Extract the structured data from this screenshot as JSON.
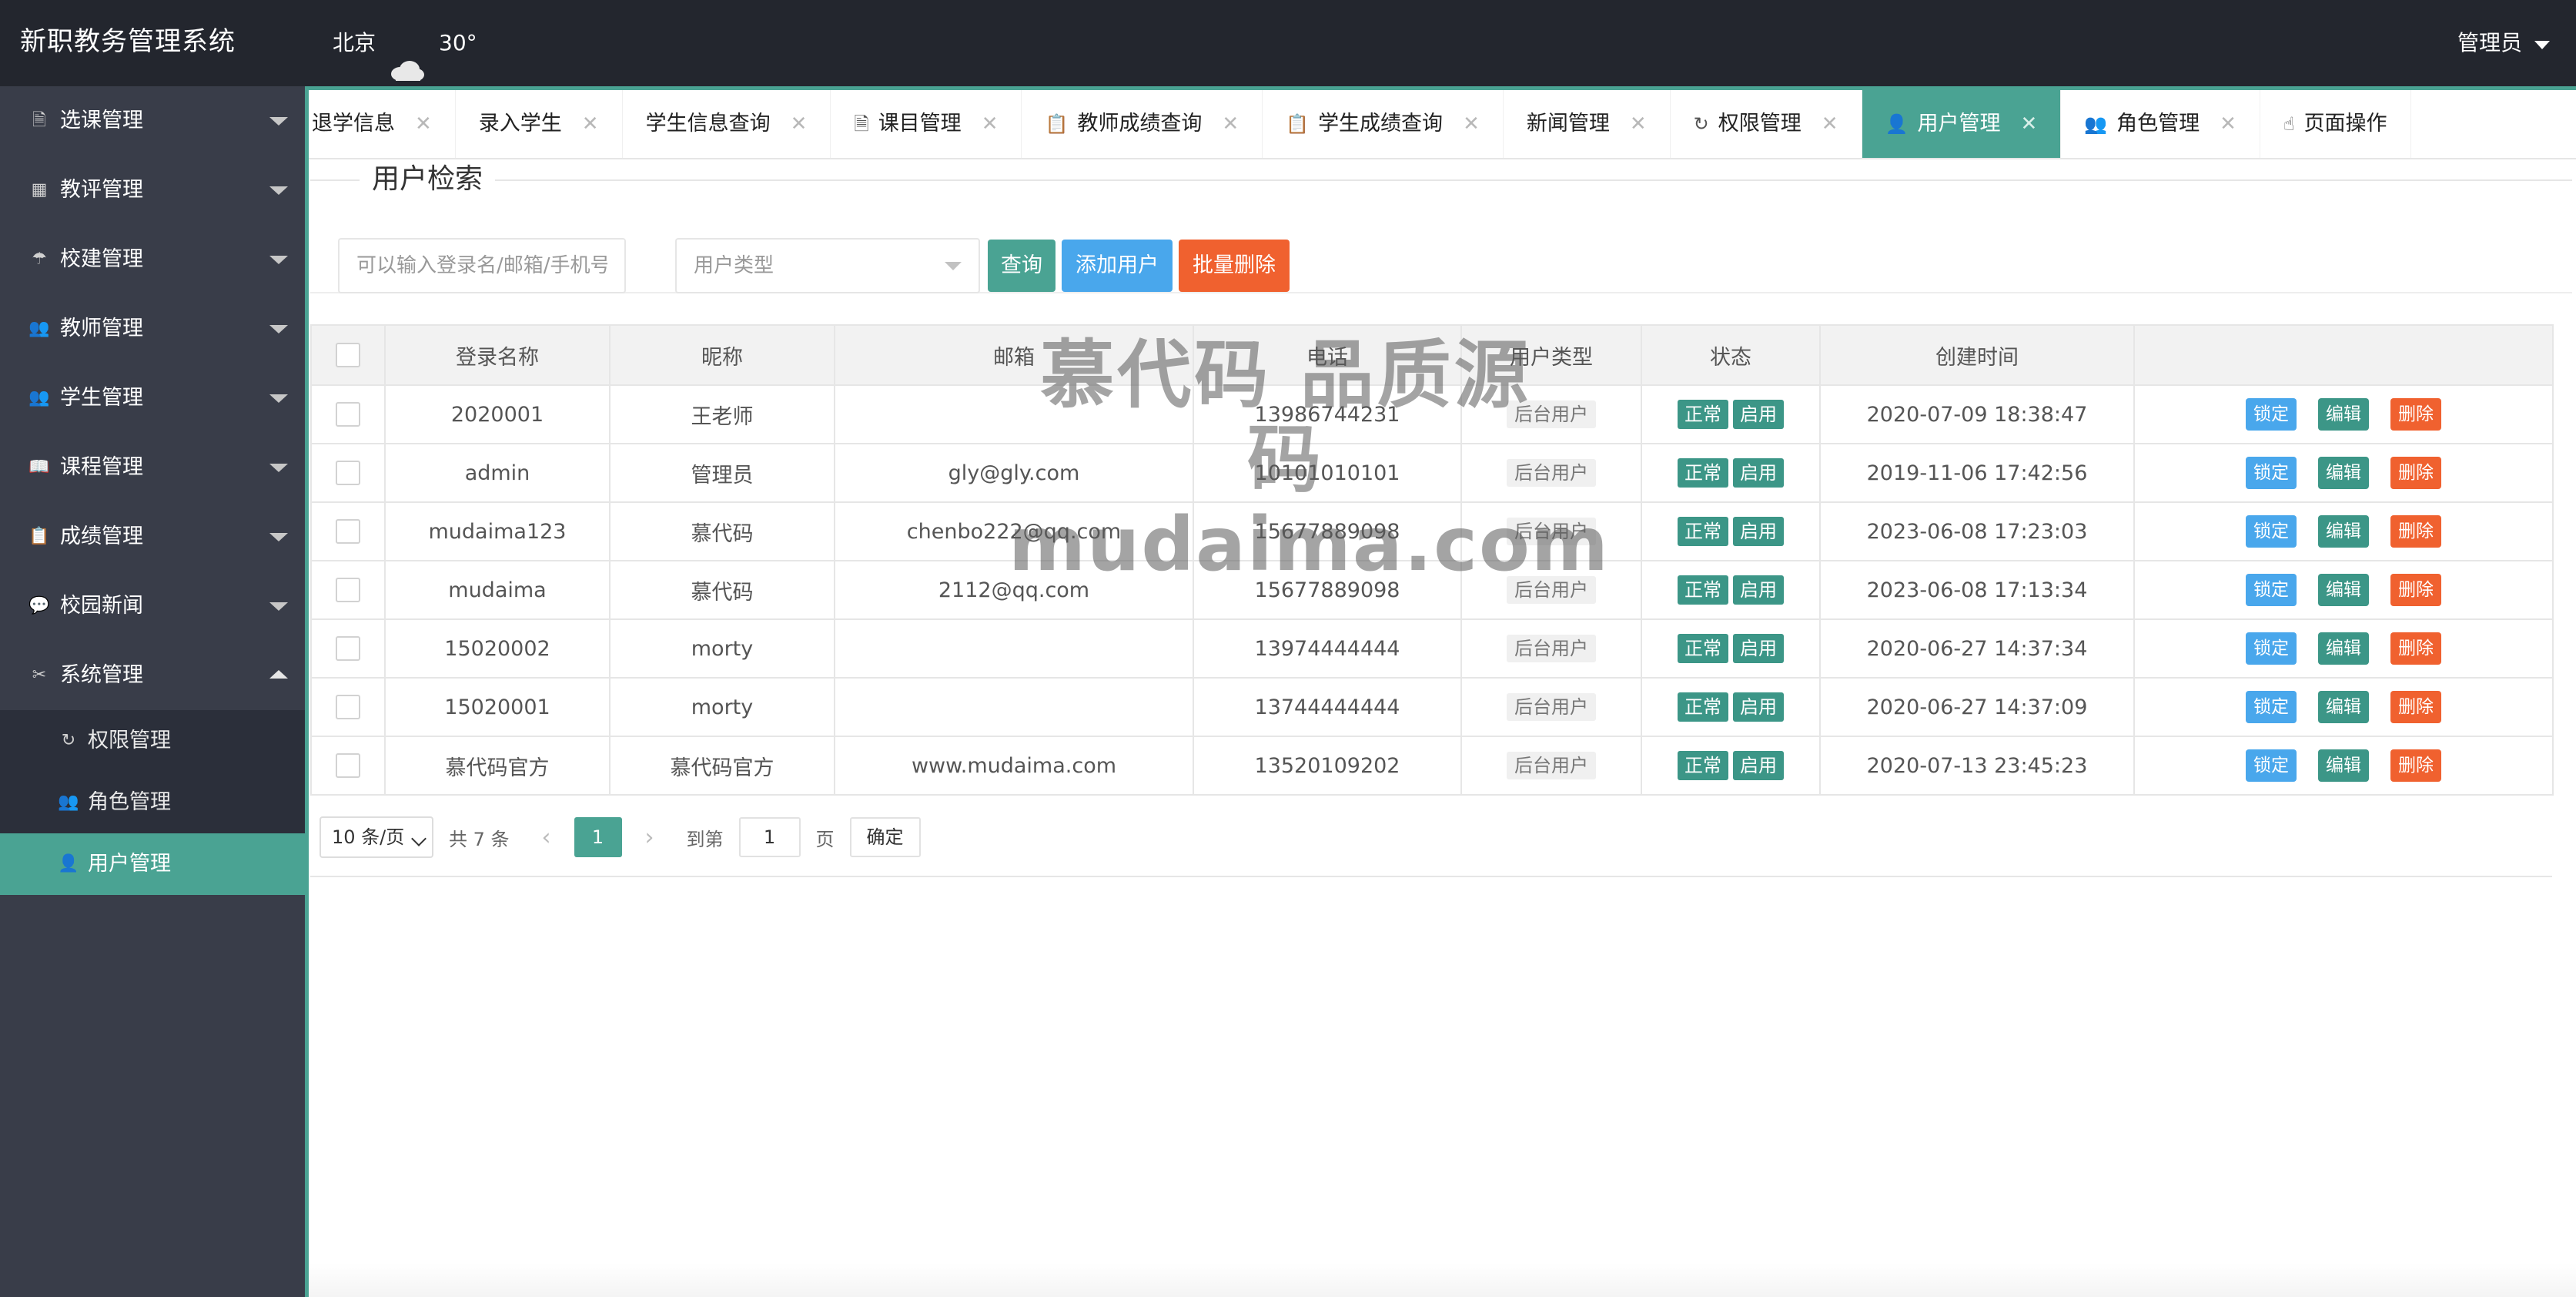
{
  "header": {
    "app_title": "新职教务管理系统",
    "weather_city": "北京",
    "weather_icon": "cloud-icon",
    "weather_temp": "30°",
    "user_name": "管理员"
  },
  "sidebar": {
    "items": [
      {
        "label": "选课管理",
        "icon": "document-icon"
      },
      {
        "label": "教评管理",
        "icon": "grid-icon"
      },
      {
        "label": "校建管理",
        "icon": "umbrella-icon"
      },
      {
        "label": "教师管理",
        "icon": "users-icon"
      },
      {
        "label": "学生管理",
        "icon": "users-icon"
      },
      {
        "label": "课程管理",
        "icon": "book-icon"
      },
      {
        "label": "成绩管理",
        "icon": "clipboard-icon"
      },
      {
        "label": "校园新闻",
        "icon": "chat-icon"
      },
      {
        "label": "系统管理",
        "icon": "tools-icon"
      }
    ],
    "submenu": [
      {
        "label": "权限管理",
        "icon": "refresh-icon"
      },
      {
        "label": "角色管理",
        "icon": "users-icon"
      },
      {
        "label": "用户管理",
        "icon": "user-icon"
      }
    ]
  },
  "tabs": [
    {
      "label": "退学信息"
    },
    {
      "label": "录入学生"
    },
    {
      "label": "学生信息查询"
    },
    {
      "label": "课目管理"
    },
    {
      "label": "教师成绩查询"
    },
    {
      "label": "学生成绩查询"
    },
    {
      "label": "新闻管理"
    },
    {
      "label": "权限管理"
    },
    {
      "label": "用户管理"
    },
    {
      "label": "角色管理"
    },
    {
      "label": "页面操作"
    }
  ],
  "tab_close_glyph": "✕",
  "search": {
    "legend": "用户检索",
    "input_placeholder": "可以输入登录名/邮箱/手机号",
    "type_placeholder": "用户类型",
    "query_label": "查询",
    "add_label": "添加用户",
    "batch_delete_label": "批量删除"
  },
  "table": {
    "headers": {
      "login": "登录名称",
      "nickname": "昵称",
      "email": "邮箱",
      "phone": "电话",
      "type": "用户类型",
      "status": "状态",
      "created": "创建时间"
    },
    "rows": [
      {
        "login": "2020001",
        "nickname": "王老师",
        "email": "",
        "phone": "13986744231",
        "type": "后台用户",
        "status1": "正常",
        "status2": "启用",
        "created": "2020-07-09 18:38:47"
      },
      {
        "login": "admin",
        "nickname": "管理员",
        "email": "gly@gly.com",
        "phone": "10101010101",
        "type": "后台用户",
        "status1": "正常",
        "status2": "启用",
        "created": "2019-11-06 17:42:56"
      },
      {
        "login": "mudaima123",
        "nickname": "慕代码",
        "email": "chenbo222@qq.com",
        "phone": "15677889098",
        "type": "后台用户",
        "status1": "正常",
        "status2": "启用",
        "created": "2023-06-08 17:23:03"
      },
      {
        "login": "mudaima",
        "nickname": "慕代码",
        "email": "2112@qq.com",
        "phone": "15677889098",
        "type": "后台用户",
        "status1": "正常",
        "status2": "启用",
        "created": "2023-06-08 17:13:34"
      },
      {
        "login": "15020002",
        "nickname": "morty",
        "email": "",
        "phone": "13974444444",
        "type": "后台用户",
        "status1": "正常",
        "status2": "启用",
        "created": "2020-06-27 14:37:34"
      },
      {
        "login": "15020001",
        "nickname": "morty",
        "email": "",
        "phone": "13744444444",
        "type": "后台用户",
        "status1": "正常",
        "status2": "启用",
        "created": "2020-06-27 14:37:09"
      },
      {
        "login": "慕代码官方",
        "nickname": "慕代码官方",
        "email": "www.mudaima.com",
        "phone": "13520109202",
        "type": "后台用户",
        "status1": "正常",
        "status2": "启用",
        "created": "2020-07-13 23:45:23"
      }
    ],
    "actions": {
      "lock": "锁定",
      "edit": "编辑",
      "delete": "删除"
    }
  },
  "pagination": {
    "page_size": "10 条/页",
    "total": "共 7 条",
    "current_page": "1",
    "goto_label": "到第",
    "goto_value": "1",
    "page_unit": "页",
    "confirm_label": "确定"
  },
  "watermark": {
    "line1": "慕代码 品质源码",
    "line2": "mudaima.com"
  }
}
